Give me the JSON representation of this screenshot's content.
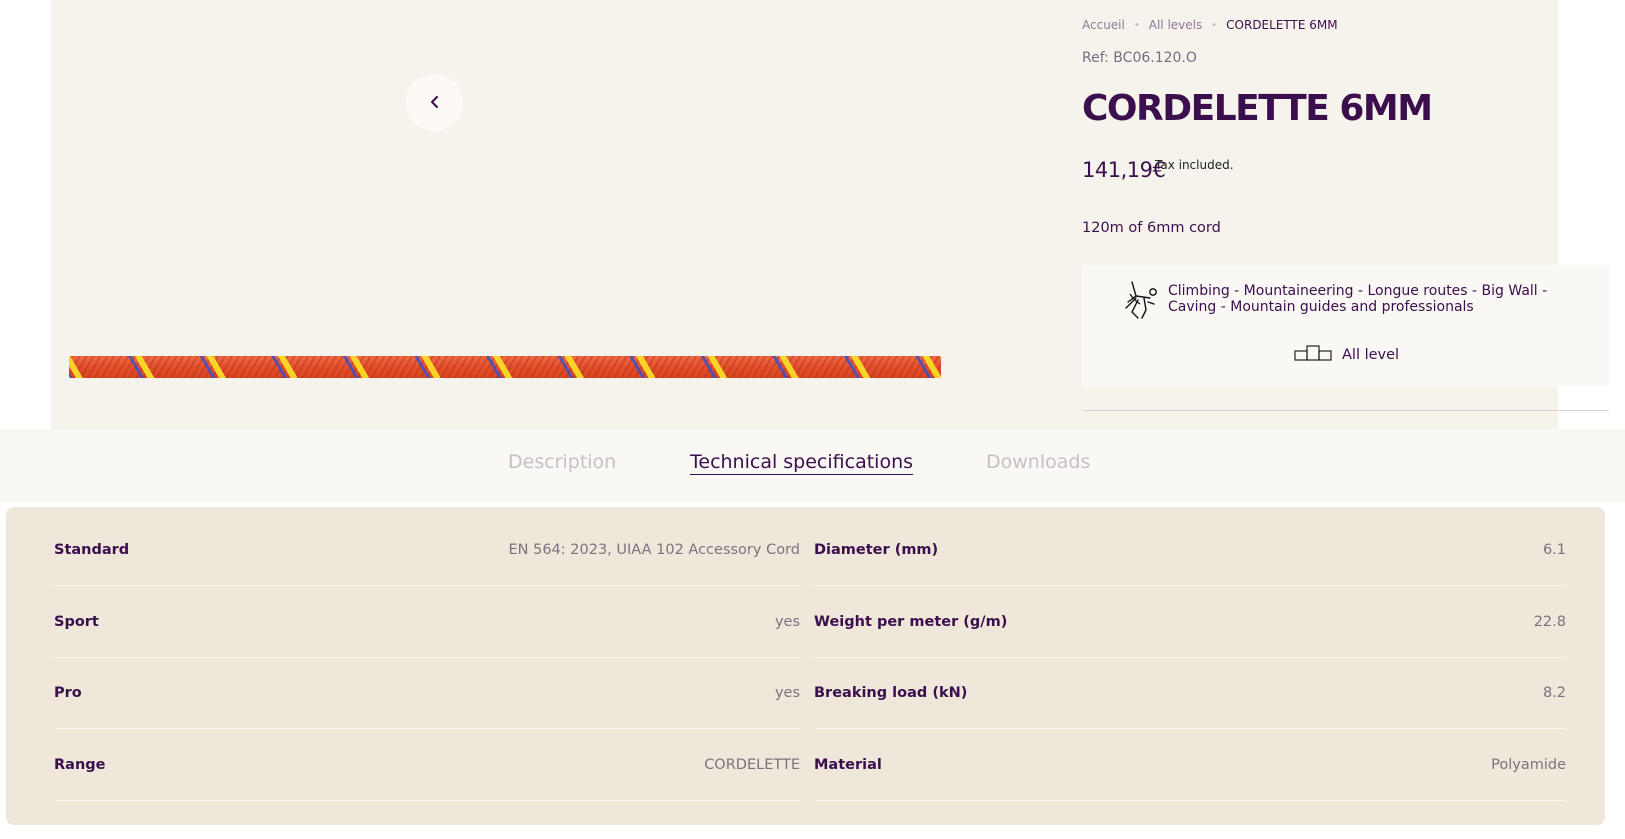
{
  "gallery": {
    "prev_icon": "chevron-left-icon",
    "rope_image": "rope-cordelette-image"
  },
  "breadcrumb": {
    "items": [
      "Accueil",
      "All levels",
      "CORDELETTE 6MM"
    ]
  },
  "product": {
    "ref": "Ref: BC06.120.O",
    "title": "CORDELETTE 6MM",
    "price": "141,19€",
    "tax_note": "Tax included.",
    "short_description": "120m of 6mm cord",
    "activities": "Climbing - Mountaineering - Longue routes - Big Wall - Caving - Mountain guides and professionals",
    "activities_icon": "climber-icon",
    "level_icon": "podium-icon",
    "level": "All level"
  },
  "tabs": [
    {
      "label": "Description",
      "active": false
    },
    {
      "label": "Technical specifications",
      "active": true
    },
    {
      "label": "Downloads",
      "active": false
    }
  ],
  "specs": {
    "left": [
      {
        "label": "Standard",
        "value": "EN 564: 2023, UIAA 102 Accessory Cord"
      },
      {
        "label": "Sport",
        "value": "yes"
      },
      {
        "label": "Pro",
        "value": "yes"
      },
      {
        "label": "Range",
        "value": "CORDELETTE"
      }
    ],
    "right": [
      {
        "label": "Diameter (mm)",
        "value": "6.1"
      },
      {
        "label": "Weight per meter (g/m)",
        "value": "22.8"
      },
      {
        "label": "Breaking load (kN)",
        "value": "8.2"
      },
      {
        "label": "Material",
        "value": "Polyamide"
      }
    ]
  },
  "colors": {
    "brand_purple": "#3b0f4d",
    "background_beige": "#f6f3ed",
    "specs_panel": "#eee7da",
    "rope_orange": "#e5502c"
  }
}
